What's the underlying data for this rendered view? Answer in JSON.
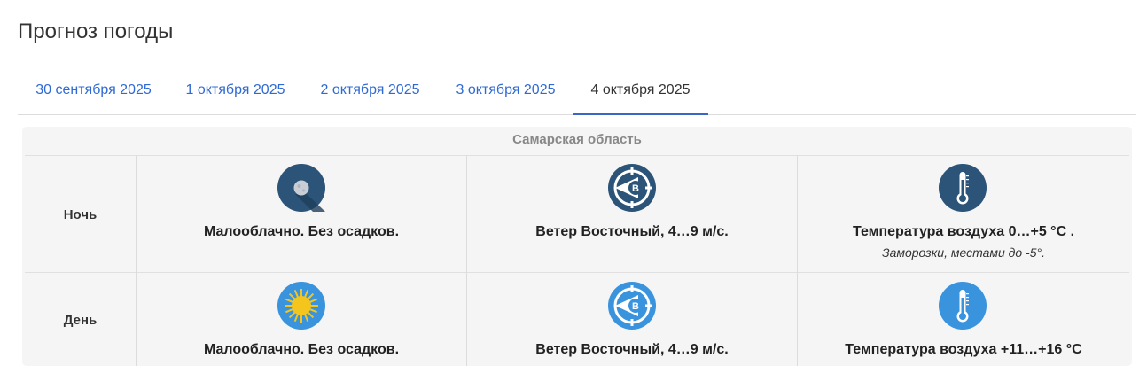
{
  "page": {
    "title": "Прогноз погоды"
  },
  "tabs": [
    {
      "label": "30 сентября 2025"
    },
    {
      "label": "1 октября 2025"
    },
    {
      "label": "2 октября 2025"
    },
    {
      "label": "3 октября 2025"
    },
    {
      "label": "4 октября 2025",
      "active": true
    }
  ],
  "forecast": {
    "region": "Самарская область",
    "rows": [
      {
        "period": "Ночь",
        "icon_color": "#2c5478",
        "sky": {
          "icon": "moon-icon",
          "text": "Малооблачно. Без осадков."
        },
        "wind": {
          "icon": "wind-direction-east-icon",
          "badge": "В",
          "text": "Ветер Восточный, 4…9 м/с."
        },
        "temperature": {
          "icon": "thermometer-icon",
          "text": "Температура воздуха 0…+5 °C .",
          "note": "Заморозки, местами до -5°."
        }
      },
      {
        "period": "День",
        "icon_color": "#3a93dd",
        "sky": {
          "icon": "sun-icon",
          "text": "Малооблачно. Без осадков."
        },
        "wind": {
          "icon": "wind-direction-east-icon",
          "badge": "В",
          "text": "Ветер Восточный, 4…9 м/с."
        },
        "temperature": {
          "icon": "thermometer-icon",
          "text": "Температура воздуха +11…+16 °C"
        }
      }
    ]
  },
  "colors": {
    "link": "#2f6ad4",
    "active_underline": "#3a67c7",
    "night_icon": "#2c5478",
    "day_icon": "#3a93dd",
    "sun": "#f4c51c"
  }
}
